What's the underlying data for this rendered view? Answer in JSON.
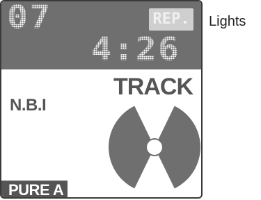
{
  "display": {
    "track_number": "07",
    "repeat_indicator": "REP.",
    "elapsed_time": "4:26",
    "nbi_label": "N.B.I",
    "track_label": "TRACK",
    "pure_direct_label": "PURE A"
  },
  "lights_label": "Lights",
  "colors": {
    "lcd_background": "#6f6f6f",
    "lcd_text": "#ffffff",
    "label_gray": "#555555",
    "disc_gray": "#6f6f6f"
  },
  "icons": {
    "disc": "disc-icon"
  }
}
